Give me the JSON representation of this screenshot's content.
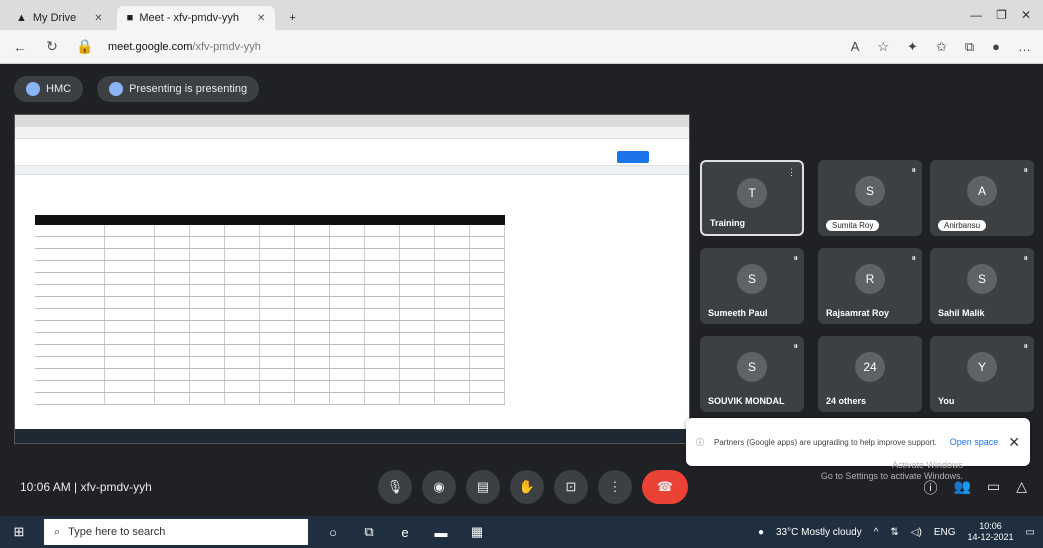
{
  "browser": {
    "tabs": [
      {
        "label": "My Drive"
      },
      {
        "label": "Meet - xfv-pmdv-yyh"
      }
    ],
    "url_host": "meet.google.com",
    "url_path": "/xfv-pmdv-yyh"
  },
  "meet": {
    "room_code_pill": "HMC",
    "presenting_label": "Presenting is presenting",
    "meeting_time": "10:06 AM",
    "meeting_code": "xfv-pmdv-yyh",
    "participants": [
      {
        "name": "Training",
        "initial": "T"
      },
      {
        "name": "Sumita Roy",
        "initial": "S"
      },
      {
        "name": "Anirbansu",
        "initial": "A"
      },
      {
        "name": "Sumeeth Paul",
        "initial": "S"
      },
      {
        "name": "Rajsamrat Roy",
        "initial": "R"
      },
      {
        "name": "Sahil Malik",
        "initial": "S"
      },
      {
        "name": "SOUVIK MONDAL",
        "initial": "S"
      },
      {
        "name": "24 others",
        "initial": "24"
      },
      {
        "name": "You",
        "initial": "Y"
      }
    ],
    "toast": {
      "message": "Partners (Google apps) are upgrading to help improve support.",
      "action": "Open space",
      "close": "✕"
    },
    "activate_windows": "Activate Windows",
    "activate_sub": "Go to Settings to activate Windows."
  },
  "taskbar": {
    "search_placeholder": "Type here to search",
    "weather": "33°C Mostly cloudy",
    "lang": "ENG",
    "time": "10:06",
    "date": "14-12-2021"
  }
}
